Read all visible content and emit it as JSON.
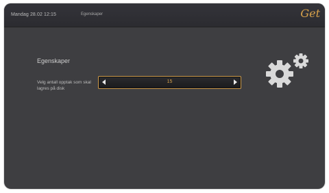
{
  "topbar": {
    "datetime": "Mandag 28.02 12:15",
    "breadcrumb": "Egenskaper",
    "logo": "Get"
  },
  "main": {
    "title": "Egenskaper",
    "setting_label": "Velg antall opptak som skal lagres på disk",
    "value": "15"
  },
  "icons": [
    "gear-icon",
    "arrow-left-icon",
    "arrow-right-icon"
  ]
}
